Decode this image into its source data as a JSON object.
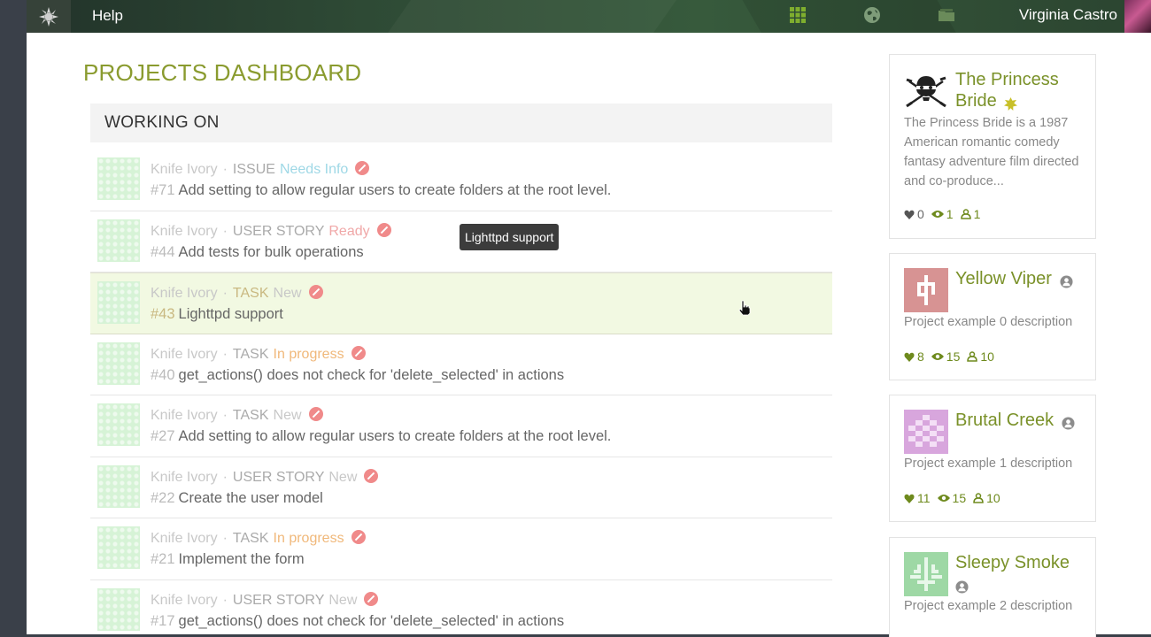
{
  "topbar": {
    "help_label": "Help",
    "user_name": "Virginia Castro",
    "icons": [
      "logo-icon",
      "grid-icon",
      "globe-icon",
      "folder-icon"
    ]
  },
  "page": {
    "title": "PROJECTS DASHBOARD",
    "section_title": "WORKING ON"
  },
  "tooltip": "Lighttpd support",
  "tasks": [
    {
      "project": "Knife Ivory",
      "type": "ISSUE",
      "status": "Needs Info",
      "status_color": "#9fd8e6",
      "ref": "#71",
      "title": "Add setting to allow regular users to create folders at the root level."
    },
    {
      "project": "Knife Ivory",
      "type": "USER STORY",
      "status": "Ready",
      "status_color": "#f0a8a8",
      "ref": "#44",
      "title": "Add tests for bulk operations"
    },
    {
      "project": "Knife Ivory",
      "type": "TASK",
      "status": "New",
      "status_color": "#c8c8c8",
      "ref": "#43",
      "title": "Lighttpd support"
    },
    {
      "project": "Knife Ivory",
      "type": "TASK",
      "status": "In progress",
      "status_color": "#f0b87a",
      "ref": "#40",
      "title": "get_actions() does not check for 'delete_selected' in actions"
    },
    {
      "project": "Knife Ivory",
      "type": "TASK",
      "status": "New",
      "status_color": "#c8c8c8",
      "ref": "#27",
      "title": "Add setting to allow regular users to create folders at the root level."
    },
    {
      "project": "Knife Ivory",
      "type": "USER STORY",
      "status": "New",
      "status_color": "#c8c8c8",
      "ref": "#22",
      "title": "Create the user model"
    },
    {
      "project": "Knife Ivory",
      "type": "TASK",
      "status": "In progress",
      "status_color": "#f0b87a",
      "ref": "#21",
      "title": "Implement the form"
    },
    {
      "project": "Knife Ivory",
      "type": "USER STORY",
      "status": "New",
      "status_color": "#c8c8c8",
      "ref": "#17",
      "title": "get_actions() does not check for 'delete_selected' in actions"
    }
  ],
  "projects": [
    {
      "name": "The Princess Bride",
      "description": "The Princess Bride is a 1987 American romantic comedy fantasy adventure film directed and co-produce...",
      "likes": "0",
      "watchers": "1",
      "members": "1",
      "badge": "featured-badge-icon"
    },
    {
      "name": "Yellow Viper",
      "description": "Project example 0 description",
      "likes": "8",
      "watchers": "15",
      "members": "10",
      "badge": "private-badge-icon"
    },
    {
      "name": "Brutal Creek",
      "description": "Project example 1 description",
      "likes": "11",
      "watchers": "15",
      "members": "10",
      "badge": "private-badge-icon"
    },
    {
      "name": "Sleepy Smoke",
      "description": "Project example 2 description",
      "badge": "private-badge-icon"
    }
  ],
  "colors": {
    "accent": "#8a9b2f",
    "project_name": "#7a9129",
    "stats_green": "#6e8a1d",
    "highlight_row": "#f2f9e2",
    "blocked": "#f08a8a"
  }
}
